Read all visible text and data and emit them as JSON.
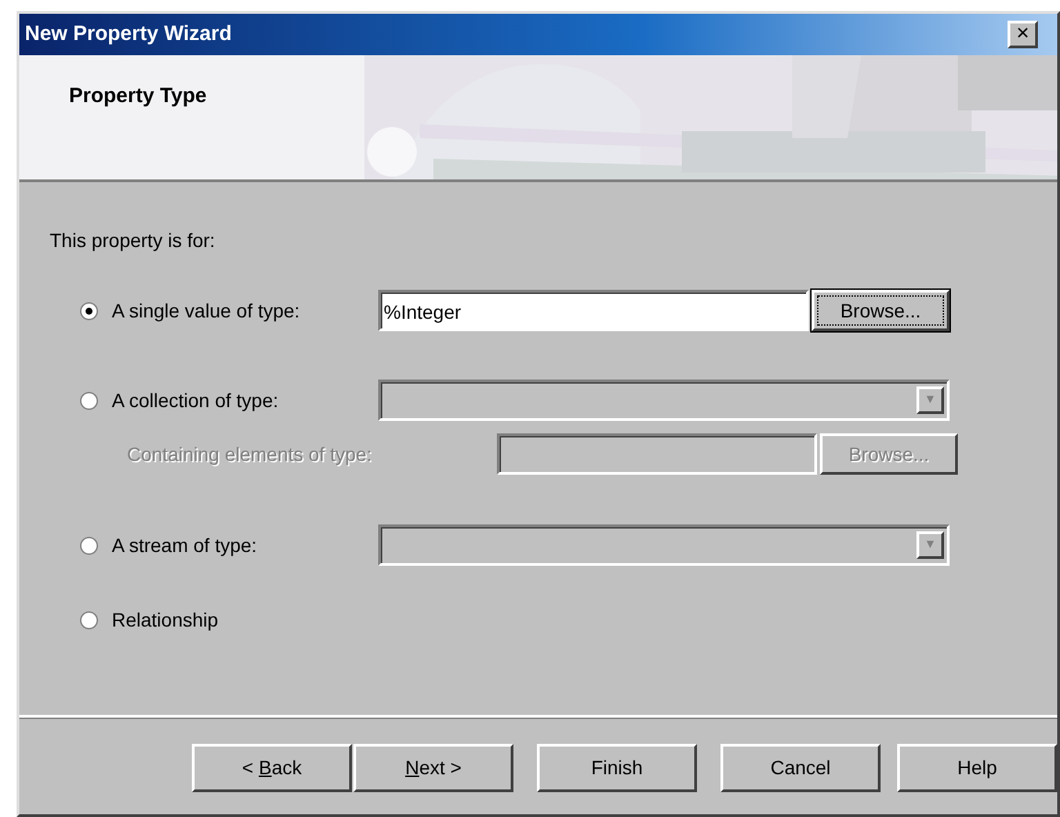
{
  "window": {
    "title": "New Property Wizard",
    "close": "×"
  },
  "header": {
    "title": "Property Type"
  },
  "intro": "This property is for:",
  "options": [
    {
      "label": "A single value of type:",
      "selected": true,
      "field": {
        "kind": "text",
        "value": "%Integer",
        "disabled": false
      },
      "browse": {
        "label": "Browse...",
        "disabled": false,
        "focused": true
      }
    },
    {
      "label": "A collection of type:",
      "selected": false,
      "field": {
        "kind": "combo",
        "arrow": "▼",
        "disabled": true
      },
      "sub": {
        "label": "Containing elements of type:",
        "disabled": true,
        "field": {
          "kind": "text",
          "disabled": true
        },
        "browse": {
          "label": "Browse...",
          "disabled": true,
          "focused": false
        }
      }
    },
    {
      "label": "A stream of type:",
      "selected": false,
      "field": {
        "kind": "combo",
        "arrow": "▼",
        "disabled": true
      }
    },
    {
      "label": "Relationship",
      "selected": false
    }
  ],
  "buttons": [
    {
      "pre": "< ",
      "key": "B",
      "post": "ack"
    },
    {
      "key": "N",
      "post": "ext >"
    },
    {
      "pre": "Finish"
    },
    {
      "pre": "Cancel"
    },
    {
      "pre": "Help"
    }
  ]
}
